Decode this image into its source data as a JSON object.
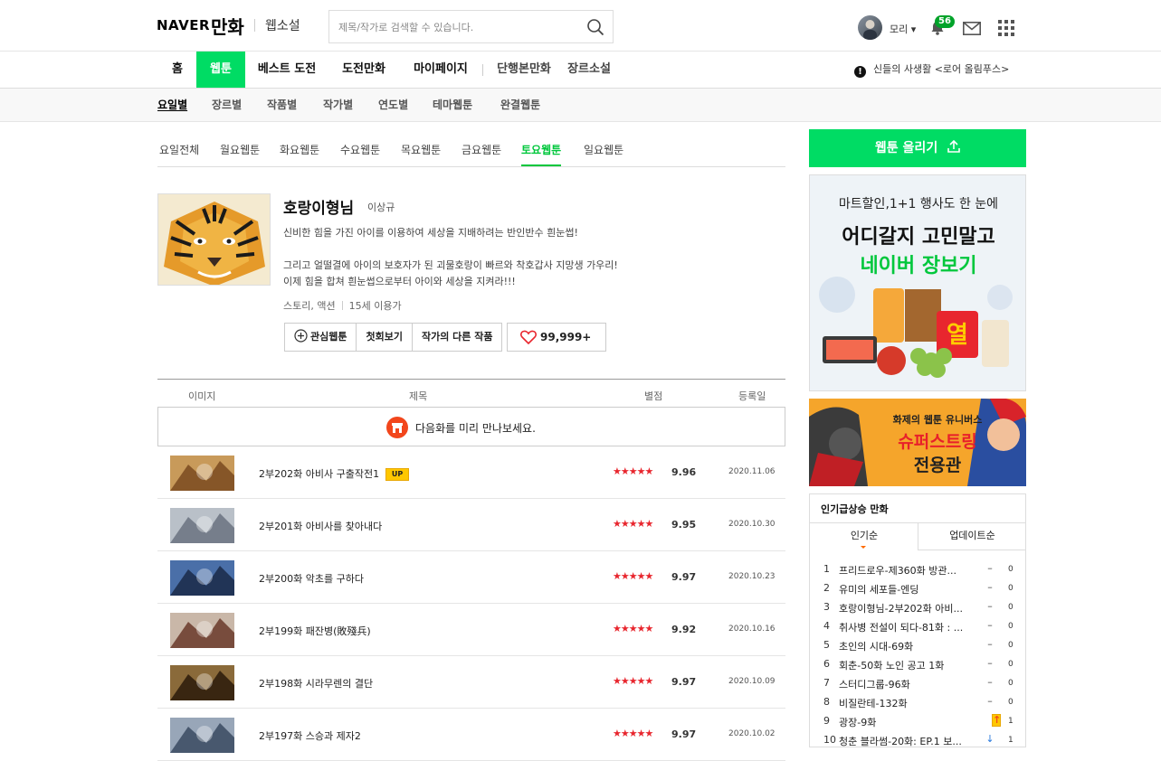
{
  "header": {
    "logo_naver": "NAVER",
    "logo_manhwa": "만화",
    "logo_novel": "웹소설",
    "search_placeholder": "제목/작가로 검색할 수 있습니다.",
    "username": "모리 ▾",
    "notification_count": "56"
  },
  "gnb": {
    "items": [
      "홈",
      "웹툰",
      "베스트 도전",
      "도전만화",
      "마이페이지",
      "단행본만화",
      "장르소설"
    ],
    "active": "웹툰",
    "notice_icon": "!",
    "notice": "신들의 사생활 <로어 올림푸스>"
  },
  "lnb": {
    "items": [
      "요일별",
      "장르별",
      "작품별",
      "작가별",
      "연도별",
      "테마웹툰",
      "완결웹툰"
    ],
    "active": "요일별"
  },
  "days": {
    "items": [
      "요일전체",
      "월요웹툰",
      "화요웹툰",
      "수요웹툰",
      "목요웹툰",
      "금요웹툰",
      "토요웹툰",
      "일요웹툰"
    ],
    "active": "토요웹툰"
  },
  "comic": {
    "title": "호랑이형님",
    "author": "이상규",
    "desc1": "신비한 힘을 가진 아이를 이용하여 세상을 지배하려는 반인반수 흰눈썹!",
    "desc2": "그리고 얼떨결에 아이의 보호자가 된 괴물호랑이 빠르와 착호갑사 지망생 가우리!",
    "desc3": "이제 힘을 합쳐 흰눈썹으로부터 아이와 세상을 지켜라!!!",
    "genre": "스토리, 액션",
    "age": "15세 이용가",
    "btn_fav": "관심웹툰",
    "btn_first": "첫회보기",
    "btn_other": "작가의 다른 작품",
    "likes": "99,999+"
  },
  "list": {
    "headers": {
      "image": "이미지",
      "title": "제목",
      "rating": "별점",
      "date": "등록일"
    },
    "preview": "다음화를 미리 만나보세요.",
    "up_badge": "UP",
    "stars": "★★★★★",
    "episodes": [
      {
        "title": "2부202화 아비사 구출작전1",
        "score": "9.96",
        "date": "2020.11.06",
        "up": true
      },
      {
        "title": "2부201화 아비사를 찾아내다",
        "score": "9.95",
        "date": "2020.10.30",
        "up": false
      },
      {
        "title": "2부200화 악초를 구하다",
        "score": "9.97",
        "date": "2020.10.23",
        "up": false
      },
      {
        "title": "2부199화 패잔병(敗殘兵)",
        "score": "9.92",
        "date": "2020.10.16",
        "up": false
      },
      {
        "title": "2부198화 시라무렌의 결단",
        "score": "9.97",
        "date": "2020.10.09",
        "up": false
      },
      {
        "title": "2부197화 스승과 제자2",
        "score": "9.97",
        "date": "2020.10.02",
        "up": false
      }
    ]
  },
  "sidebar": {
    "upload": "웹툰 올리기",
    "ad1_l1": "마트할인,1+1 행사도 한 눈에",
    "ad1_l2": "어디갈지 고민말고",
    "ad1_l3": "네이버 장보기",
    "ad2_l1": "화제의 웹툰 유니버스",
    "ad2_l2": "슈퍼스트링",
    "ad2_l3": "전용관",
    "rank_title": "인기급상승 만화",
    "tab_popular": "인기순",
    "tab_update": "업데이트순",
    "ranks": [
      {
        "num": "1",
        "title": "프리드로우-제360화 방관...",
        "chg": "–",
        "dir": "same",
        "cnt": "0"
      },
      {
        "num": "2",
        "title": "유미의 세포들-엔딩",
        "chg": "–",
        "dir": "same",
        "cnt": "0"
      },
      {
        "num": "3",
        "title": "호랑이형님-2부202화 아비...",
        "chg": "–",
        "dir": "same",
        "cnt": "0"
      },
      {
        "num": "4",
        "title": "취사병 전설이 되다-81화 : ...",
        "chg": "–",
        "dir": "same",
        "cnt": "0"
      },
      {
        "num": "5",
        "title": "초인의 시대-69화",
        "chg": "–",
        "dir": "same",
        "cnt": "0"
      },
      {
        "num": "6",
        "title": "회춘-50화 노인 공고 1화",
        "chg": "–",
        "dir": "same",
        "cnt": "0"
      },
      {
        "num": "7",
        "title": "스터디그룹-96화",
        "chg": "–",
        "dir": "same",
        "cnt": "0"
      },
      {
        "num": "8",
        "title": "비질란테-132화",
        "chg": "–",
        "dir": "same",
        "cnt": "0"
      },
      {
        "num": "9",
        "title": "광장-9화",
        "chg": "↑",
        "dir": "up",
        "cnt": "1"
      },
      {
        "num": "10",
        "title": "청춘 블라썸-20화: EP.1 보...",
        "chg": "↓",
        "dir": "down",
        "cnt": "1"
      }
    ]
  }
}
